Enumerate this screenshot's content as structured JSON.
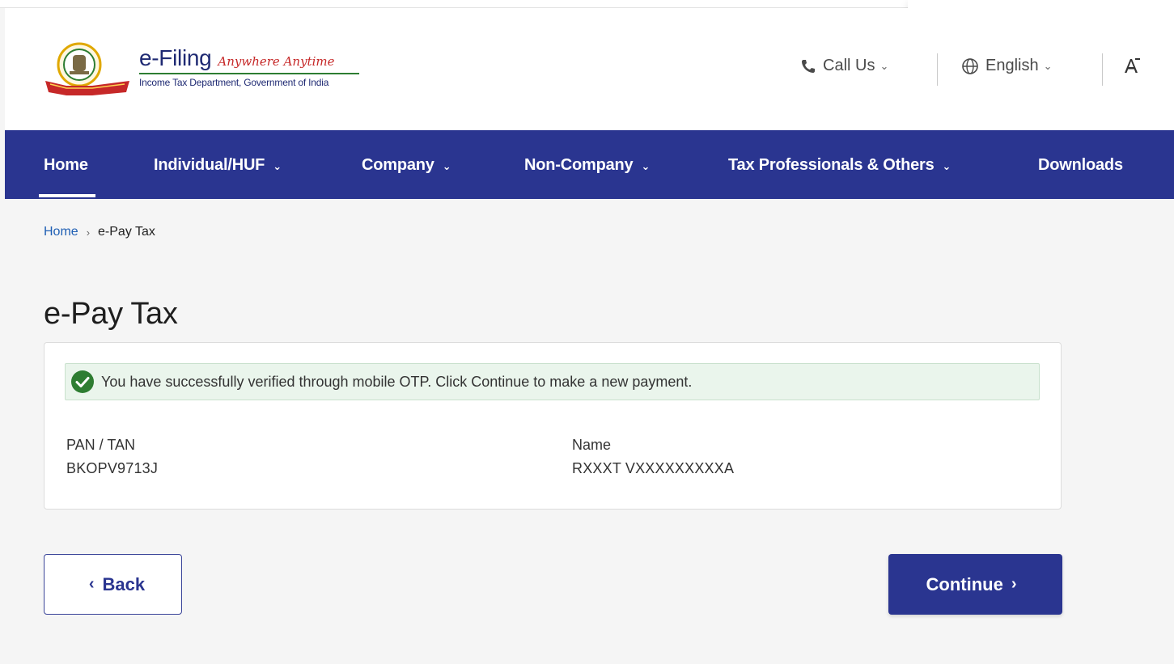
{
  "header": {
    "brand_name": "e-Filing",
    "brand_tagline": "Anywhere Anytime",
    "brand_subtitle": "Income Tax Department, Government of India",
    "call_us": "Call Us",
    "language": "English",
    "font_size_icon": "font-size-icon",
    "colors": {
      "brand_blue": "#1f2a73",
      "tagline_red": "#c62828",
      "rule_green": "#2e7d32"
    }
  },
  "nav": {
    "color": "#2a3590",
    "items": [
      {
        "label": "Home",
        "active": true
      },
      {
        "label": "Individual/HUF",
        "has_dropdown": true
      },
      {
        "label": "Company",
        "has_dropdown": true
      },
      {
        "label": "Non-Company",
        "has_dropdown": true
      },
      {
        "label": "Tax Professionals & Others",
        "has_dropdown": true
      },
      {
        "label": "Downloads"
      }
    ]
  },
  "breadcrumb": {
    "home": "Home",
    "current": "e-Pay Tax"
  },
  "page": {
    "title": "e-Pay Tax"
  },
  "card": {
    "success_message": "You have successfully verified through mobile OTP. Click Continue to make a new payment.",
    "success_icon": "check-circle-icon",
    "success_color": "#2e7d32",
    "pan_label": "PAN / TAN",
    "pan_value": "BKOPV9713J",
    "name_label": "Name",
    "name_value": "RXXXT VXXXXXXXXXA"
  },
  "actions": {
    "back_label": "Back",
    "continue_label": "Continue"
  }
}
